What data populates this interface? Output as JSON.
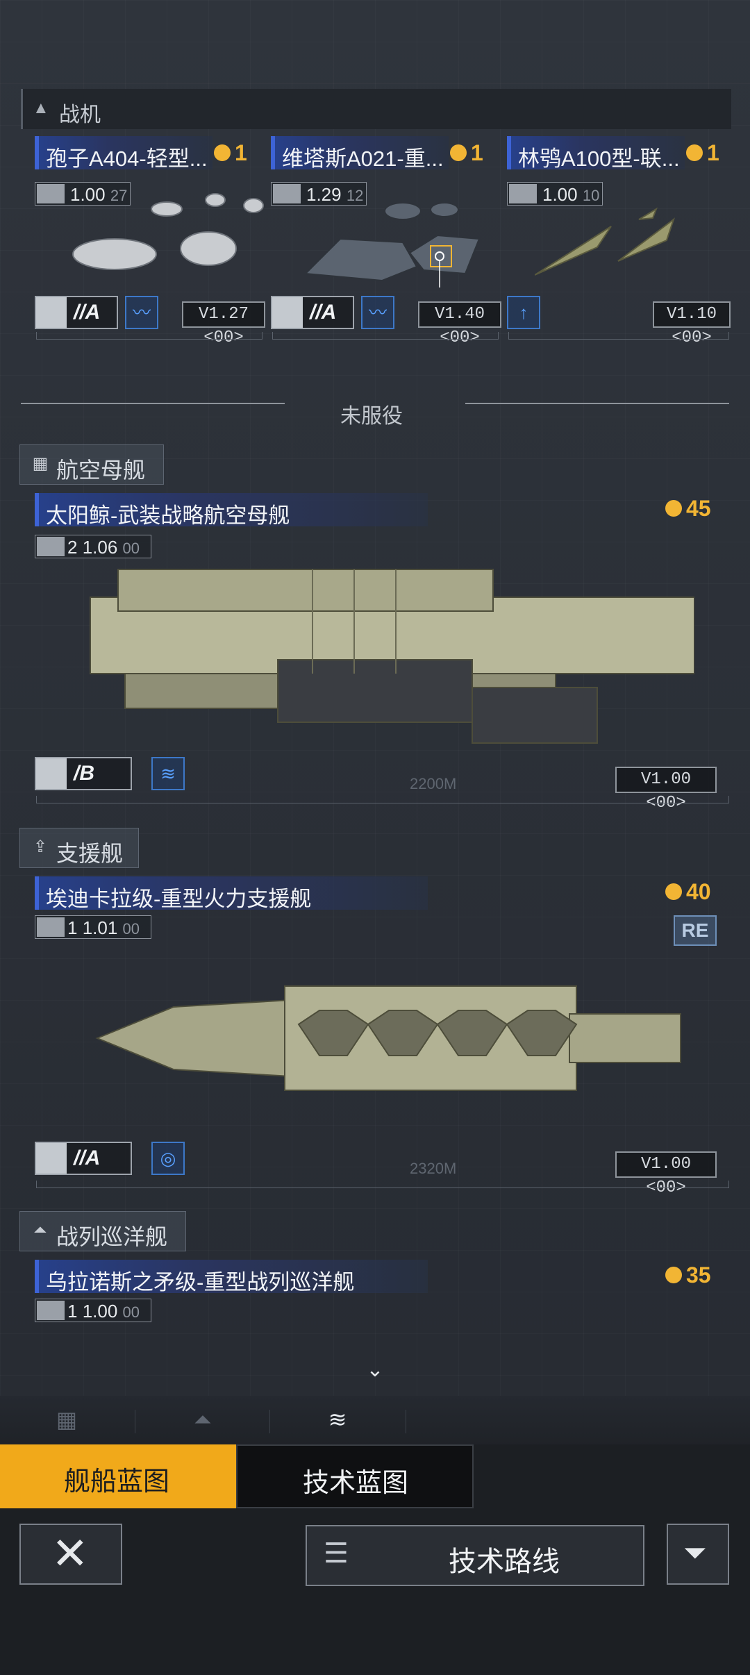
{
  "fighters": {
    "section_label": "战机",
    "cards": [
      {
        "name": "孢子A404-轻型...",
        "cost": "1",
        "stat": "1.00",
        "stat_sub": "27",
        "grade": "//A",
        "version": "V1.27 <00>"
      },
      {
        "name": "维塔斯A021-重...",
        "cost": "1",
        "stat": "1.29",
        "stat_sub": "12",
        "grade": "//A",
        "version": "V1.40 <00>"
      },
      {
        "name": "林鸮A100型-联...",
        "cost": "1",
        "stat": "1.00",
        "stat_sub": "10",
        "version": "V1.10 <00>"
      }
    ]
  },
  "inactive_divider": "未服役",
  "carrier": {
    "section_label": "航空母舰",
    "name": "太阳鲸-武装战略航空母舰",
    "cost": "45",
    "stat_prefix": "2",
    "stat": "1.06",
    "stat_sub": "00",
    "grade": "/B",
    "version": "V1.00 <00>",
    "length": "2200M"
  },
  "support": {
    "section_label": "支援舰",
    "name": "埃迪卡拉级-重型火力支援舰",
    "cost": "40",
    "badge": "RE",
    "stat_prefix": "1",
    "stat": "1.01",
    "stat_sub": "00",
    "grade": "//A",
    "version": "V1.00 <00>",
    "length": "2320M"
  },
  "cruiser": {
    "section_label": "战列巡洋舰",
    "name": "乌拉诺斯之矛级-重型战列巡洋舰",
    "cost": "35",
    "stat_prefix": "1",
    "stat": "1.00",
    "stat_sub": "00"
  },
  "bottom_tabs": {
    "ship_blueprint": "舰船蓝图",
    "tech_blueprint": "技术蓝图"
  },
  "bottom_bar": {
    "tech_route": "技术路线"
  },
  "colors": {
    "accent_gold": "#f2b534",
    "name_blue": "#3d63d6",
    "active_tab": "#f1a91a"
  }
}
